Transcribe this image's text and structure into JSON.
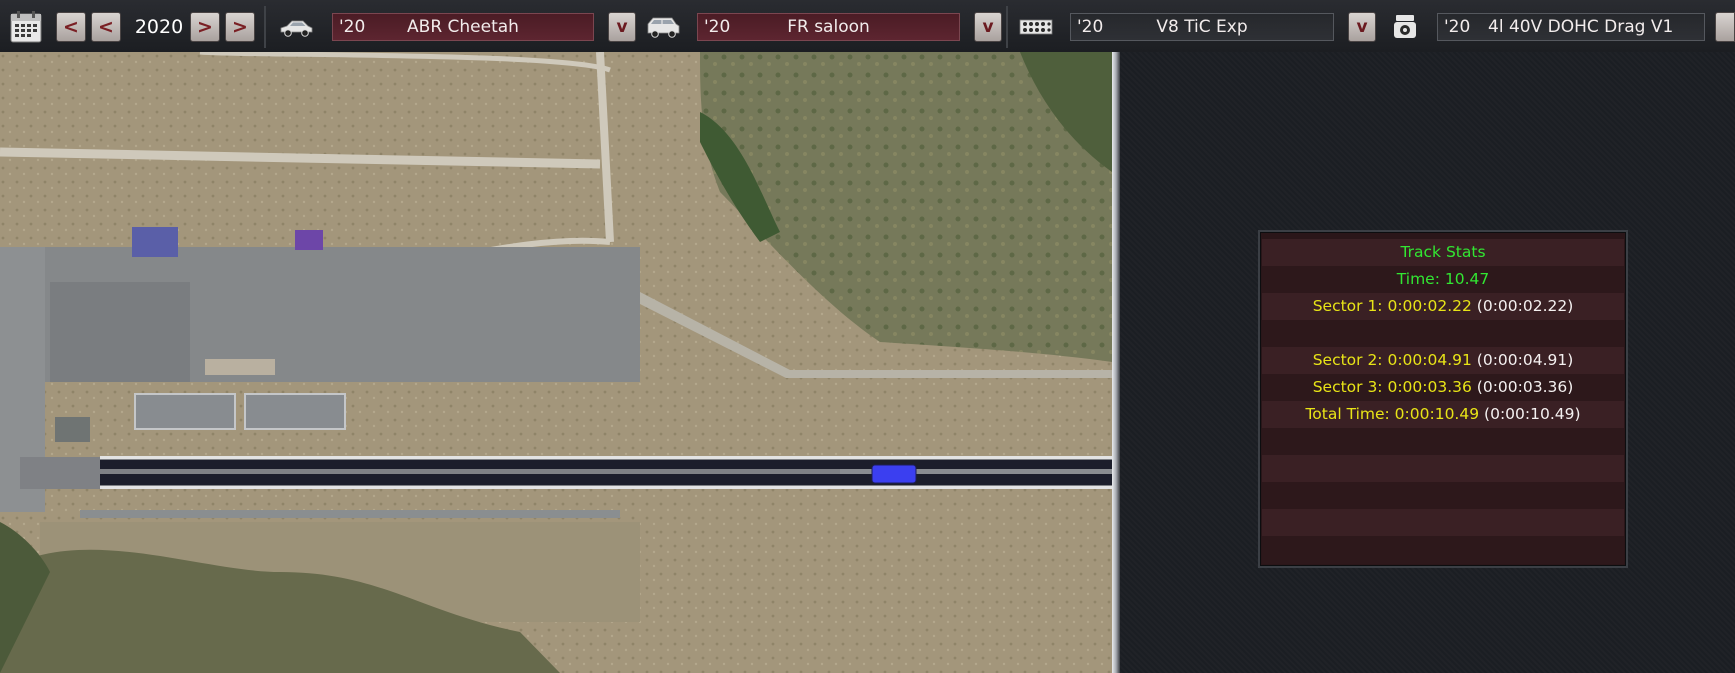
{
  "toolbar": {
    "year": "2020",
    "prev_fast_label": "<",
    "prev_label": "<",
    "next_label": ">",
    "next_fast_label": ">",
    "expand_label": "v",
    "car": {
      "year": "'20",
      "name": "ABR Cheetah"
    },
    "trim": {
      "year": "'20",
      "name": "FR saloon"
    },
    "engine": {
      "year": "'20",
      "name": "V8 TiC Exp"
    },
    "engine_variant": {
      "year": "'20",
      "name": "4l 40V DOHC Drag V1"
    }
  },
  "track_stats": {
    "title": "Track Stats",
    "time": "Time: 10.47",
    "sectors": [
      {
        "label": "Sector 1: 0:00:02.22",
        "best": "(0:00:02.22)"
      },
      {
        "label": "Sector 2: 0:00:04.91",
        "best": "(0:00:04.91)"
      },
      {
        "label": "Sector 3: 0:00:03.36",
        "best": "(0:00:03.36)"
      }
    ],
    "total": {
      "label": "Total Time: 0:00:10.49",
      "best": "(0:00:10.49)"
    }
  },
  "colors": {
    "accent_green": "#32e632",
    "accent_yellow": "#e8e417",
    "field_maroon": "#5d2530",
    "car_marker": "#3b3ff0"
  },
  "icons": [
    "calendar-icon",
    "car-model-icon",
    "trim-body-icon",
    "engine-block-icon",
    "engine-variant-icon"
  ]
}
